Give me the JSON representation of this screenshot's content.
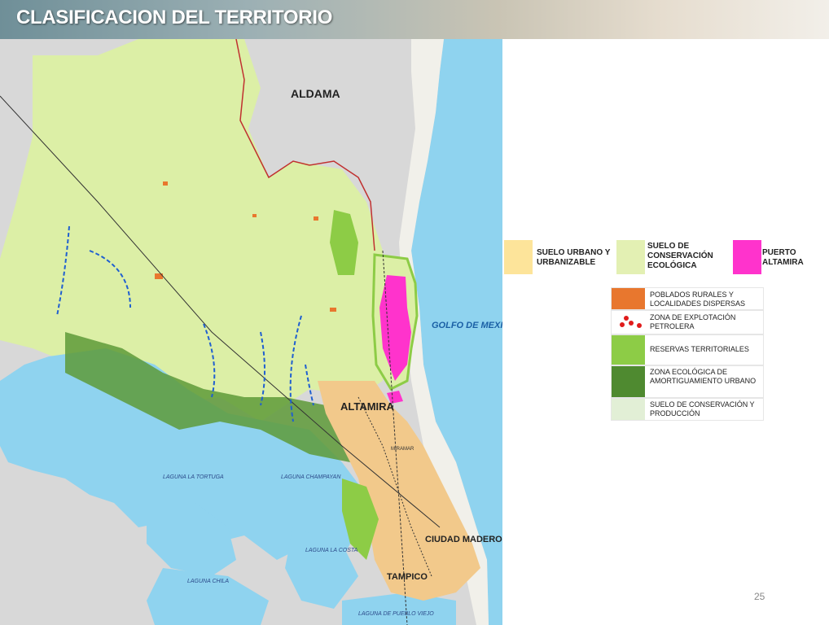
{
  "header": {
    "title": "CLASIFICACION DEL TERRITORIO"
  },
  "map": {
    "labels": {
      "aldama": "ALDAMA",
      "golfo": "GOLFO DE MEXICO",
      "altamira": "ALTAMIRA",
      "ciudad_madero": "CIUDAD MADERO",
      "tampico": "TAMPICO",
      "laguna_tortuga": "LAGUNA LA TORTUGA",
      "laguna_chila": "LAGUNA CHILA",
      "laguna_costa": "LAGUNA LA COSTA",
      "laguna_pueblo_viejo": "LAGUNA DE PUEBLO VIEJO",
      "laguna_champayan": "LAGUNA CHAMPAYAN",
      "miramar": "MIRAMAR"
    },
    "colors": {
      "land_conservation": "#dcefa6",
      "water": "#8fd3ef",
      "urban": "#f2c98b",
      "port": "#ff33cc",
      "reserve": "#8dcc46",
      "buffer": "#5e9a38",
      "rural": "#e8772e"
    }
  },
  "legend_top": [
    {
      "label": "SUELO URBANO Y URBANIZABLE",
      "color": "#fde49a"
    },
    {
      "label": "SUELO DE CONSERVACIÓN ECOLÓGICA",
      "color": "#e3f0b3"
    },
    {
      "label": "PUERTO ALTAMIRA",
      "color": "#ff33cc"
    }
  ],
  "legend_low": [
    {
      "label": "POBLADOS RURALES Y LOCALIDADES DISPERSAS",
      "color": "#e8772e"
    },
    {
      "label": "ZONA DE EXPLOTACIÓN PETROLERA",
      "color": "#ffffff",
      "marker": "red-dots"
    },
    {
      "label": "RESERVAS TERRITORIALES",
      "color": "#8dcc46"
    },
    {
      "label": "ZONA ECOLÓGICA DE AMORTIGUAMIENTO URBANO",
      "color": "#4f8a30"
    },
    {
      "label": "SUELO DE CONSERVACIÓN Y PRODUCCIÓN",
      "color": "#e2efd6"
    }
  ],
  "page_number": "25"
}
